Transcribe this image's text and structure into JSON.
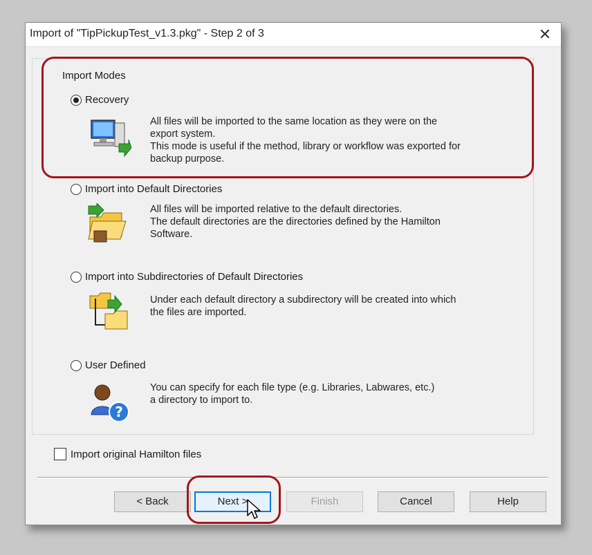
{
  "window": {
    "title": "Import of \"TipPickupTest_v1.3.pkg\" - Step 2 of 3",
    "close_glyph": "✕"
  },
  "group": {
    "label": "Import Modes"
  },
  "modes": [
    {
      "label": "Recovery",
      "checked": true,
      "icon": "computer-restore-icon",
      "desc": [
        "All files will be imported to the same location as they were on the",
        "export system.",
        "This mode is useful if the method, library or workflow was exported for",
        "backup purpose."
      ]
    },
    {
      "label": "Import into Default Directories",
      "checked": false,
      "icon": "folder-import-icon",
      "desc": [
        "All files will be imported relative to the default directories.",
        "The default directories are the directories defined by the Hamilton",
        "Software."
      ]
    },
    {
      "label": "Import into Subdirectories of Default Directories",
      "checked": false,
      "icon": "subfolder-import-icon",
      "desc": [
        "Under each default directory a subdirectory will be created into which",
        "the files are imported."
      ]
    },
    {
      "label": "User Defined",
      "checked": false,
      "icon": "user-help-icon",
      "desc": [
        "You can specify for each file type (e.g. Libraries, Labwares, etc.)",
        "a directory to import to."
      ]
    }
  ],
  "options": {
    "import_original_label": "Import original Hamilton files",
    "import_original_checked": false
  },
  "buttons": {
    "back": "< Back",
    "next": "Next >",
    "finish": "Finish",
    "cancel": "Cancel",
    "help": "Help"
  },
  "colors": {
    "highlight": "#a3151b",
    "default_button_border": "#0078d7"
  }
}
